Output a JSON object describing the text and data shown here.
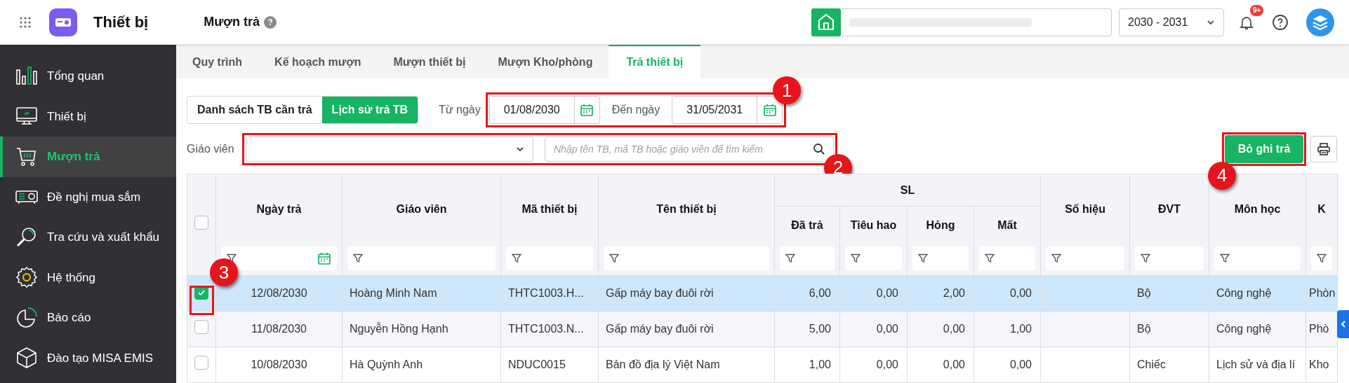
{
  "app": {
    "title": "Thiết bị"
  },
  "page": {
    "title": "Mượn trả",
    "help": "?"
  },
  "header": {
    "year": "2030 - 2031",
    "notification_count": "9+"
  },
  "sidebar": {
    "items": [
      {
        "label": "Tổng quan",
        "selected": false
      },
      {
        "label": "Thiết bị",
        "selected": false
      },
      {
        "label": "Mượn trả",
        "selected": true
      },
      {
        "label": "Đề nghị mua sắm",
        "selected": false
      },
      {
        "label": "Tra cứu và xuất khẩu",
        "selected": false
      },
      {
        "label": "Hệ thống",
        "selected": false
      },
      {
        "label": "Báo cáo",
        "selected": false
      },
      {
        "label": "Đào tạo MISA EMIS",
        "selected": false
      }
    ]
  },
  "tabs": [
    {
      "label": "Quy trình",
      "selected": false
    },
    {
      "label": "Kế hoạch mượn",
      "selected": false
    },
    {
      "label": "Mượn thiết bị",
      "selected": false
    },
    {
      "label": "Mượn Kho/phòng",
      "selected": false
    },
    {
      "label": "Trả thiết bị",
      "selected": true
    }
  ],
  "view_toggle": [
    {
      "label": "Danh sách TB cần trả",
      "selected": false
    },
    {
      "label": "Lịch sử trả TB",
      "selected": true
    }
  ],
  "date_range": {
    "from_label": "Từ ngày",
    "from": "01/08/2030",
    "to_label": "Đến ngày",
    "to": "31/05/2031",
    "callout": "1"
  },
  "filters": {
    "teacher_label": "Giáo viên",
    "search_placeholder": "Nhập tên TB, mã TB hoặc giáo viên để tìm kiếm",
    "callout": "2"
  },
  "actions": {
    "unrecord_button": "Bỏ ghi trả",
    "callout": "4"
  },
  "table": {
    "all_selected": false,
    "selection_callout": "3",
    "columns": [
      {
        "label": "Ngày trả",
        "kind": "date"
      },
      {
        "label": "Giáo viên",
        "kind": "text"
      },
      {
        "label": "Mã thiết bị",
        "kind": "text"
      },
      {
        "label": "Tên thiết bị",
        "kind": "text"
      },
      {
        "label": "SL",
        "children": [
          {
            "label": "Đã trả",
            "kind": "text"
          },
          {
            "label": "Tiêu hao",
            "kind": "text"
          },
          {
            "label": "Hỏng",
            "kind": "text"
          },
          {
            "label": "Mất",
            "kind": "text"
          }
        ]
      },
      {
        "label": "Số hiệu",
        "kind": "text"
      },
      {
        "label": "ĐVT",
        "kind": "text"
      },
      {
        "label": "Môn học",
        "kind": "text"
      },
      {
        "label": "K",
        "kind": "text"
      }
    ],
    "rows": [
      {
        "selected": true,
        "date": "12/08/2030",
        "teacher": "Hoàng Minh Nam",
        "code": "THTC1003.H...",
        "name": "Gấp máy bay đuôi rời",
        "returned": "6,00",
        "consumed": "0,00",
        "damaged": "2,00",
        "lost": "0,00",
        "unit": "Bộ",
        "subject": "Công nghệ",
        "column_12": "Phòn"
      },
      {
        "selected": false,
        "date": "11/08/2030",
        "teacher": "Nguyễn Hồng Hạnh",
        "code": "THTC1003.N...",
        "name": "Gấp máy bay đuôi rời",
        "returned": "5,00",
        "consumed": "0,00",
        "damaged": "0,00",
        "lost": "1,00",
        "unit": "Bộ",
        "subject": "Công nghệ",
        "column_12": "Phò"
      },
      {
        "selected": false,
        "date": "10/08/2030",
        "teacher": "Hà Quỳnh Anh",
        "code": "NDUC0015",
        "name": "Bản đồ địa lý Việt Nam",
        "returned": "1,00",
        "consumed": "0,00",
        "damaged": "0,00",
        "lost": "0,00",
        "unit": "Chiếc",
        "subject": "Lịch sử và địa lí",
        "column_12": "Kho"
      }
    ]
  }
}
